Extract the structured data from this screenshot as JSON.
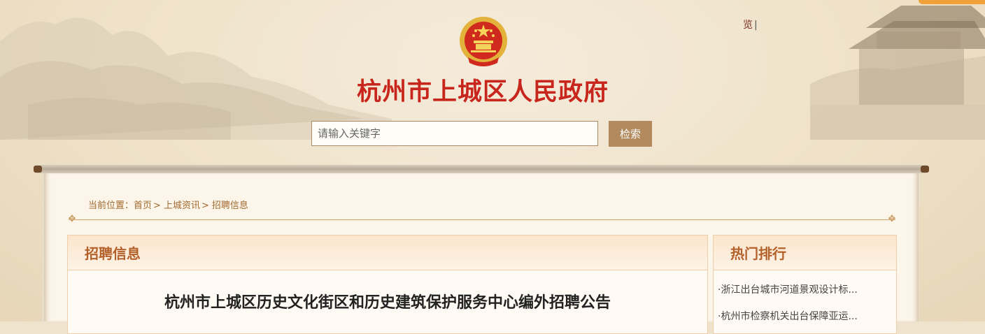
{
  "header": {
    "top_link": "览",
    "top_link_sep": "|",
    "site_title": "杭州市上城区人民政府"
  },
  "search": {
    "placeholder": "请输入关键字",
    "button_label": "检索"
  },
  "breadcrumb": {
    "prefix": "当前位置：",
    "items": [
      "首页",
      "上城资讯",
      "招聘信息"
    ],
    "separator": ">"
  },
  "main": {
    "section_title": "招聘信息",
    "article_title": "杭州市上城区历史文化街区和历史建筑保护服务中心编外招聘公告"
  },
  "sidebar": {
    "title": "热门排行",
    "items": [
      "·浙江出台城市河道景观设计标...",
      "·杭州市检察机关出台保障亚运..."
    ]
  },
  "colors": {
    "title_red": "#c8261c",
    "accent_brown": "#b28a5d",
    "breadcrumb": "#a36a2e",
    "panel_head_text": "#b3602a",
    "corner_tab": "#f0a238"
  },
  "icons": [
    "national-emblem-icon",
    "ornament-icon"
  ]
}
